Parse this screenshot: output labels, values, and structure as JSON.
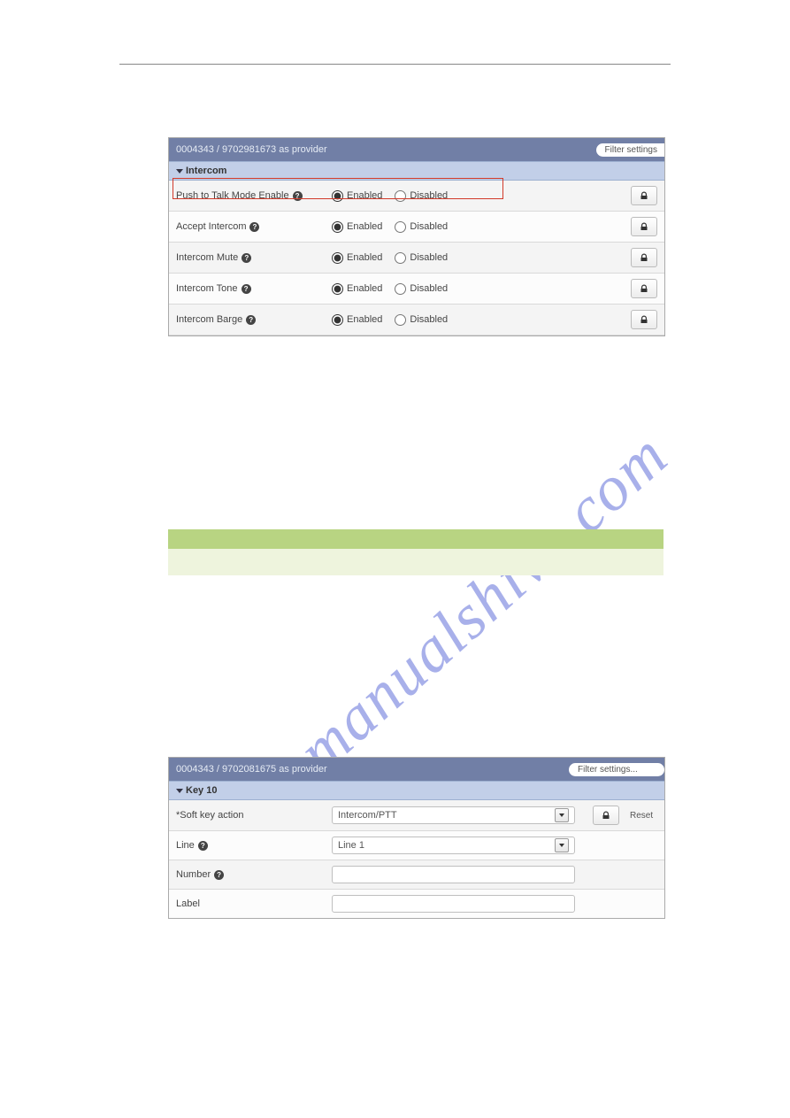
{
  "panel1": {
    "title": "0004343 / 9702981673 as provider",
    "filter": "Filter settings",
    "section": "Intercom",
    "rows": [
      {
        "label": "Push to Talk Mode Enable",
        "opt_enabled": "Enabled",
        "opt_disabled": "Disabled"
      },
      {
        "label": "Accept Intercom",
        "opt_enabled": "Enabled",
        "opt_disabled": "Disabled"
      },
      {
        "label": "Intercom Mute",
        "opt_enabled": "Enabled",
        "opt_disabled": "Disabled"
      },
      {
        "label": "Intercom Tone",
        "opt_enabled": "Enabled",
        "opt_disabled": "Disabled"
      },
      {
        "label": "Intercom Barge",
        "opt_enabled": "Enabled",
        "opt_disabled": "Disabled"
      }
    ]
  },
  "panel2": {
    "title": "0004343 / 9702081675 as provider",
    "filter": "Filter settings...",
    "section": "Key 10",
    "reset": "Reset",
    "rows": {
      "action_label": "*Soft key action",
      "action_value": "Intercom/PTT",
      "line_label": "Line",
      "line_value": "Line 1",
      "number_label": "Number",
      "number_value": "",
      "label_label": "Label",
      "label_value": ""
    }
  },
  "watermark": "manualshive.com"
}
